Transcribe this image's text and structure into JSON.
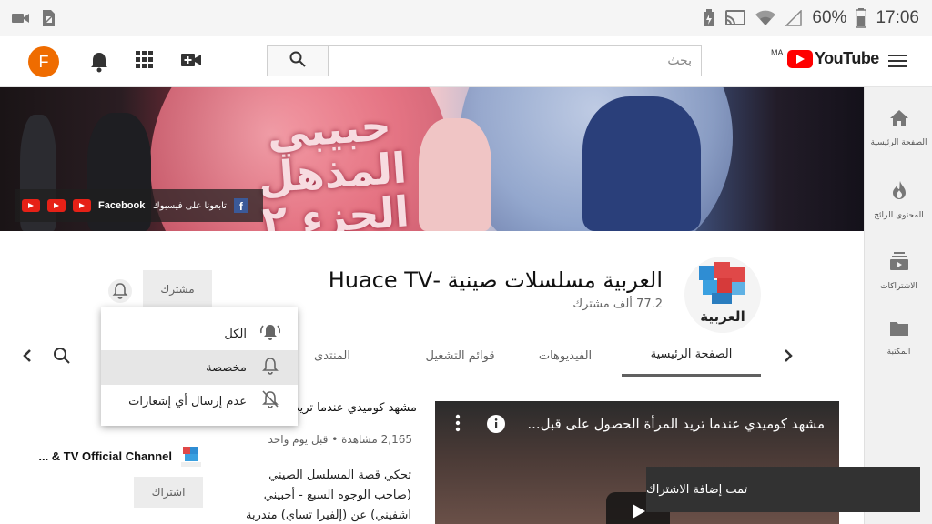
{
  "status_bar": {
    "battery": "60%",
    "time": "17:06"
  },
  "header": {
    "avatar_letter": "F",
    "search_placeholder": "بحث",
    "region": "MA",
    "logo_text": "YouTube"
  },
  "rail": {
    "items": [
      {
        "label": "الصفحة الرئيسية",
        "icon": "home-icon"
      },
      {
        "label": "المحتوى الرائج",
        "icon": "trending-icon"
      },
      {
        "label": "الاشتراكات",
        "icon": "subscriptions-icon"
      },
      {
        "label": "المكتبة",
        "icon": "library-icon"
      }
    ]
  },
  "banner": {
    "title": "حبيبي المذهل الجزء ٢",
    "facebook_label": "Facebook",
    "facebook_arabic": "تابعونا على فيسبوك"
  },
  "channel": {
    "name": "العربية مسلسلات صينية -Huace TV",
    "subscribers": "77.2 ألف مشترك",
    "subscribed_label": "مشترك",
    "logo_text": "العربية"
  },
  "tabs": [
    {
      "label": "الصفحة الرئيسية",
      "active": true
    },
    {
      "label": "الفيديوهات",
      "active": false
    },
    {
      "label": "قوائم التشغيل",
      "active": false
    },
    {
      "label": "المنتدى",
      "active": false
    }
  ],
  "notification_menu": {
    "items": [
      {
        "label": "الكل",
        "icon": "bell-ringing-icon",
        "selected": false
      },
      {
        "label": "مخصصة",
        "icon": "bell-icon",
        "selected": true
      },
      {
        "label": "عدم إرسال أي إشعارات",
        "icon": "bell-off-icon",
        "selected": false
      }
    ]
  },
  "featured_video": {
    "overlay_title": "مشهد كوميدي عندما تريد المرأة الحصول على قبل...",
    "title": "مشهد كوميدي عندما تريد",
    "meta": "2,165 مشاهدة • قبل يوم واحد",
    "description": "تحكي قصة المسلسل الصيني (صاحب الوجوه السبع - أحبيني اشفيني) عن (إلفيرا تساي) متدربة في الطب في"
  },
  "other_channel": {
    "name": "... & TV Official Channel",
    "subscribe_label": "اشتراك"
  },
  "toast": {
    "text": "تمت إضافة الاشتراك"
  },
  "colors": {
    "brand_red": "#ff0000",
    "avatar_orange": "#ef6c00"
  }
}
